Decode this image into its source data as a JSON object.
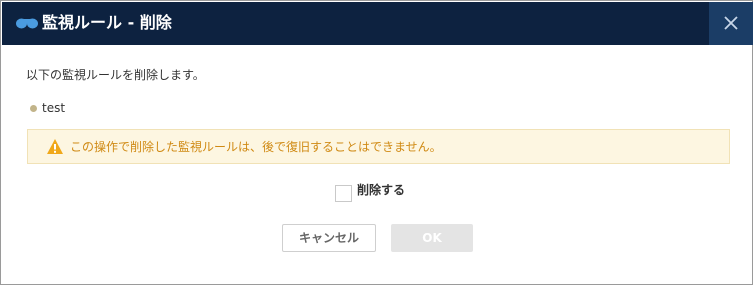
{
  "dialog": {
    "title": "監視ルール - 削除",
    "close_icon": "close-icon",
    "logo_icon": "binoculars-logo-icon"
  },
  "body": {
    "message": "以下の監視ルールを削除します。",
    "items": [
      {
        "name": "test"
      }
    ],
    "warning": {
      "icon": "warning-triangle-icon",
      "text": "この操作で削除した監視ルールは、後で復旧することはできません。"
    },
    "confirm": {
      "label": "削除する",
      "checked": false
    }
  },
  "buttons": {
    "cancel_label": "キャンセル",
    "ok_label": "OK",
    "ok_enabled": false
  },
  "colors": {
    "titlebar": "#0d2240",
    "close_button": "#1b3d66",
    "logo": "#4a9be0",
    "warning_bg": "#fdf6e1",
    "warning_text": "#d08a14",
    "bullet": "#c2b48a",
    "ok_disabled": "#e4e4e4"
  }
}
